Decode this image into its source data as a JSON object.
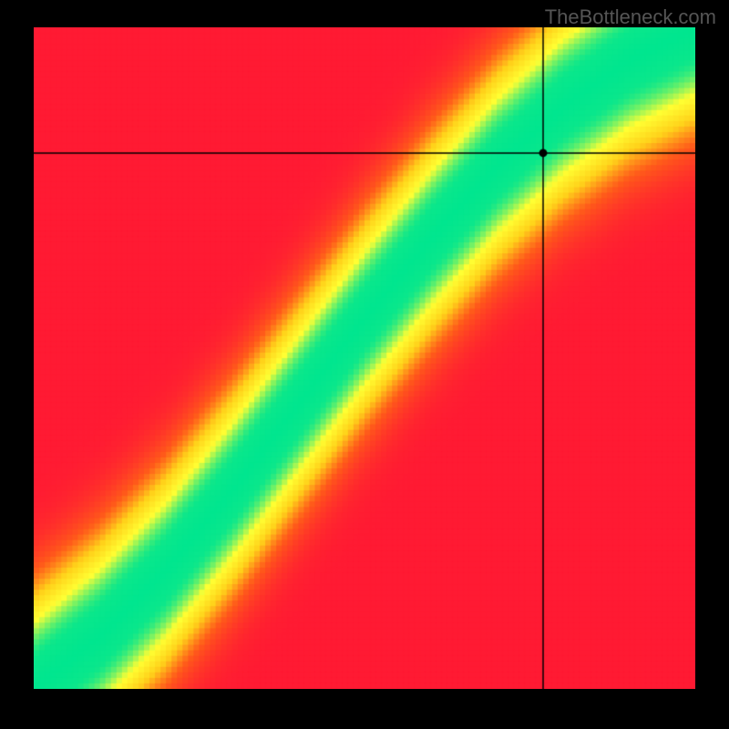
{
  "watermark": "TheBottleneck.com",
  "chart_data": {
    "type": "heatmap",
    "title": "",
    "xlabel": "",
    "ylabel": "",
    "xlim": [
      0,
      100
    ],
    "ylim": [
      0,
      100
    ],
    "crosshair": {
      "x": 77,
      "y": 81
    },
    "gradient_stops": [
      {
        "value": 0.0,
        "color": "#ff1a33"
      },
      {
        "value": 0.25,
        "color": "#ff5a1a"
      },
      {
        "value": 0.5,
        "color": "#ffd21a"
      },
      {
        "value": 0.75,
        "color": "#ffff33"
      },
      {
        "value": 1.0,
        "color": "#00e68f"
      }
    ],
    "optimal_curve": [
      {
        "x": 0,
        "y": 0
      },
      {
        "x": 10,
        "y": 8
      },
      {
        "x": 20,
        "y": 18
      },
      {
        "x": 30,
        "y": 30
      },
      {
        "x": 40,
        "y": 43
      },
      {
        "x": 50,
        "y": 56
      },
      {
        "x": 60,
        "y": 68
      },
      {
        "x": 70,
        "y": 79
      },
      {
        "x": 80,
        "y": 88
      },
      {
        "x": 90,
        "y": 95
      },
      {
        "x": 100,
        "y": 100
      }
    ],
    "band_half_width": 8,
    "description": "Diagonal optimal band (green) from bottom-left to top-right showing balanced CPU/GPU pairing; bottom-right region red (GPU bottleneck), top-left region red (CPU bottleneck). Black crosshair marks a specific configuration near the optimal band upper-right.",
    "resolution": 120
  }
}
